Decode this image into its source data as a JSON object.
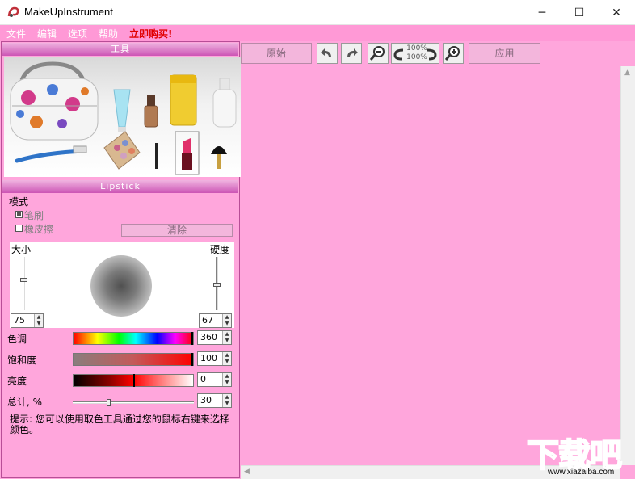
{
  "window": {
    "title": "MakeUpInstrument",
    "minimize_glyph": "─",
    "maximize_glyph": "☐",
    "close_glyph": "✕"
  },
  "menu": {
    "items": [
      "文件",
      "编辑",
      "选项",
      "帮助"
    ],
    "buy": "立即购买!"
  },
  "tools_panel": {
    "header": "工具",
    "items": [
      "bag-icon",
      "tube-icon",
      "foundation-bottle-icon",
      "cream-jar-icon",
      "lotion-bottle-icon",
      "brush-icon",
      "eyeshadow-palette-icon",
      "eyeliner-icon",
      "lipstick-icon",
      "makeup-brush-icon"
    ],
    "selected": "lipstick-icon"
  },
  "lipstick_panel": {
    "header": "Lipstick",
    "mode_label": "模式",
    "brush_option": "笔刷",
    "eraser_option": "橡皮擦",
    "clear_button": "清除",
    "size_label": "大小",
    "hardness_label": "硬度",
    "size_value": "75",
    "hardness_value": "67",
    "hue_label": "色调",
    "hue_value": "360",
    "saturation_label": "饱和度",
    "saturation_value": "100",
    "brightness_label": "亮度",
    "brightness_value": "0",
    "total_label": "总计, %",
    "total_value": "30",
    "hint": "提示: 您可以使用取色工具通过您的鼠标右键来选择颜色。",
    "spin_up": "▲",
    "spin_down": "▼"
  },
  "toolbar": {
    "original_button": "原始",
    "apply_button": "应用",
    "zoom_text_top": "100%",
    "zoom_text_bottom": "100%"
  },
  "scrollbars": {
    "up_arrow": "▲",
    "left_arrow": "◀"
  },
  "watermark": {
    "text": "下载吧",
    "url": "www.xiazaiba.com"
  },
  "colors": {
    "pink": "#ffa6dc",
    "menu_pink": "#ff99d6",
    "buy_red": "#e00000"
  }
}
